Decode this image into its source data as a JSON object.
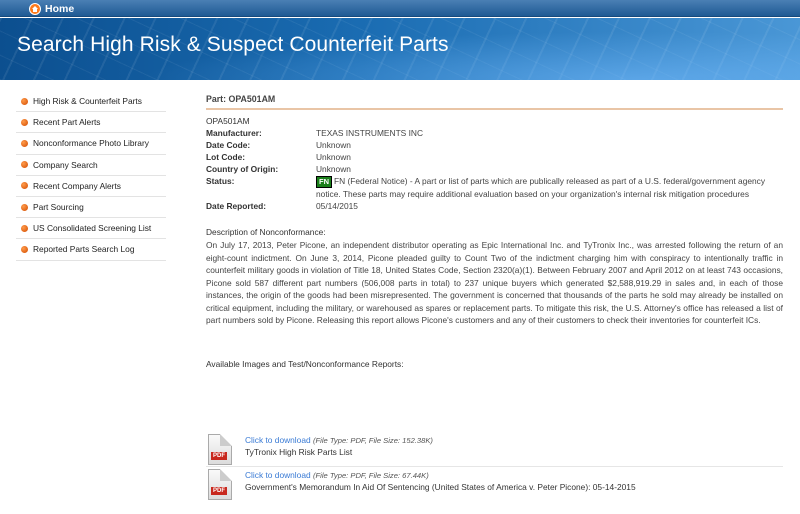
{
  "topbar": {
    "home_label": "Home"
  },
  "banner": {
    "title": "Search High Risk & Suspect Counterfeit Parts"
  },
  "sidebar": {
    "items": [
      {
        "label": "High Risk & Counterfeit Parts"
      },
      {
        "label": "Recent Part Alerts"
      },
      {
        "label": "Nonconformance Photo Library"
      },
      {
        "label": "Company Search"
      },
      {
        "label": "Recent Company Alerts"
      },
      {
        "label": "Part Sourcing"
      },
      {
        "label": "US Consolidated Screening List"
      },
      {
        "label": "Reported Parts Search Log"
      }
    ]
  },
  "part": {
    "heading": "Part: OPA501AM",
    "number": "OPA501AM",
    "fields": {
      "manufacturer_label": "Manufacturer:",
      "manufacturer": "TEXAS INSTRUMENTS INC",
      "date_code_label": "Date Code:",
      "date_code": "Unknown",
      "lot_code_label": "Lot Code:",
      "lot_code": "Unknown",
      "country_label": "Country of Origin:",
      "country": "Unknown",
      "status_label": "Status:",
      "status_badge": "FN",
      "status_text": "FN (Federal Notice) - A part or list of parts which are publically released as part of a U.S. federal/government agency notice. These parts may require additional evaluation based on your organization's internal risk mitigation procedures",
      "date_reported_label": "Date Reported:",
      "date_reported": "05/14/2015"
    },
    "description_label": "Description of Nonconformance:",
    "description": "On July 17, 2013, Peter Picone, an independent distributor operating as Epic International Inc. and TyTronix Inc., was arrested following the return of an eight-count indictment. On June 3, 2014, Picone pleaded guilty to Count Two of the indictment charging him with conspiracy to intentionally traffic in counterfeit military goods in violation of Title 18, United States Code, Section 2320(a)(1). Between February 2007 and April 2012 on at least 743 occasions, Picone sold 587 different part numbers (506,008 parts in total) to 237 unique buyers which generated $2,588,919.29 in sales and, in each of those instances, the origin of the goods had been misrepresented. The government is concerned that thousands of the parts he sold may already be installed on critical equipment, including the military, or warehoused as spares or replacement parts. To mitigate this risk, the U.S. Attorney's office has released a list of part numbers sold by Picone. Releasing this report allows Picone's customers and any of their customers to check their inventories for counterfeit ICs.",
    "available_label": "Available Images and Test/Nonconformance Reports:",
    "reports": [
      {
        "link": "Click to download",
        "info": "(File Type: PDF, File Size: 152.38K)",
        "title": "TyTronix High Risk Parts List",
        "icon_tag": "PDF"
      },
      {
        "link": "Click to download",
        "info": "(File Type: PDF, File Size: 67.44K)",
        "title": "Government's Memorandum In Aid Of Sentencing (United States of America v. Peter Picone): 05-14-2015",
        "icon_tag": "PDF"
      }
    ]
  }
}
